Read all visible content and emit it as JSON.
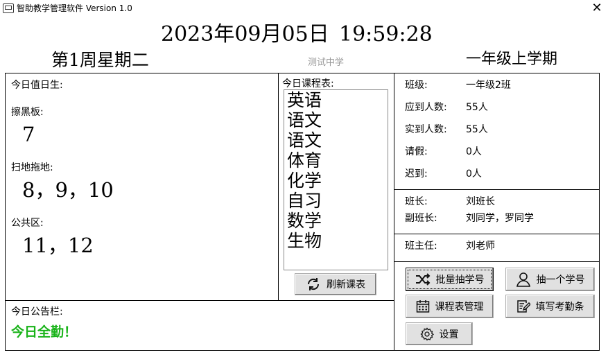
{
  "window": {
    "title": "智助教学管理软件 Version 1.0",
    "close_symbol": "✕"
  },
  "header": {
    "date": "2023年09月05日",
    "time": "19:59:28",
    "week": "第1周星期二",
    "school": "测试中学",
    "semester": "一年级上学期"
  },
  "duty": {
    "title": "今日值日生:",
    "blackboard_label": "擦黑板:",
    "blackboard_value": "7",
    "sweep_label": "扫地拖地:",
    "sweep_value": "8，9，10",
    "public_label": "公共区:",
    "public_value": "11，12"
  },
  "schedule": {
    "title": "今日课程表:",
    "courses": [
      "英语",
      "语文",
      "语文",
      "体育",
      "化学",
      "自习",
      "数学",
      "生物"
    ],
    "refresh_label": "刷新课表"
  },
  "notice": {
    "title": "今日公告栏:",
    "text": "今日全勤！",
    "text_color": "#19b319"
  },
  "class_info": {
    "class_label": "班级:",
    "class_value": "一年级2班",
    "expected_label": "应到人数:",
    "expected_value": "55人",
    "actual_label": "实到人数:",
    "actual_value": "55人",
    "leave_label": "请假:",
    "leave_value": "0人",
    "late_label": "迟到:",
    "late_value": "0人",
    "monitor_label": "班长:",
    "monitor_value": "刘班长",
    "vice_label": "副班长:",
    "vice_value": "刘同学，罗同学",
    "teacher_label": "班主任:",
    "teacher_value": "刘老师"
  },
  "buttons": {
    "batch_draw": "批量抽学号",
    "draw_one": "抽一个学号",
    "schedule_manage": "课程表管理",
    "attendance": "填写考勤条",
    "settings": "设置"
  }
}
